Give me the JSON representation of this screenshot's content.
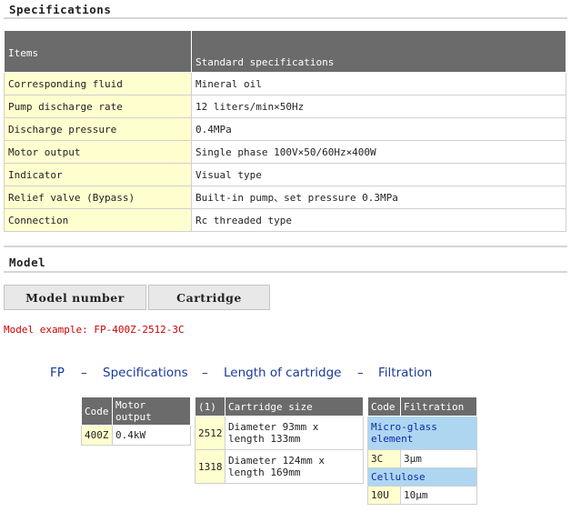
{
  "specifications": {
    "section_title": "Specifications",
    "header": {
      "items": "Items",
      "standard": "Standard specifications"
    },
    "rows": [
      {
        "item": "Corresponding fluid",
        "value": "Mineral oil"
      },
      {
        "item": "Pump discharge rate",
        "value": "12 liters/min×50Hz"
      },
      {
        "item": "Discharge pressure",
        "value": "0.4MPa"
      },
      {
        "item": "Motor output",
        "value": "Single phase 100V×50/60Hz×400W"
      },
      {
        "item": "Indicator",
        "value": "Visual type"
      },
      {
        "item": "Relief valve (Bypass)",
        "value": "Built-in pump、set pressure 0.3MPa"
      },
      {
        "item": "Connection",
        "value": "Rc threaded type"
      }
    ]
  },
  "model": {
    "section_title": "Model",
    "tabs": [
      {
        "label": "Model number",
        "active": true
      },
      {
        "label": "Cartridge",
        "active": false
      }
    ],
    "example": "Model example: FP-400Z-2512-3C",
    "formula": {
      "prefix": "FP",
      "dash": "–",
      "part1": "Specifications",
      "part2": "Length of cartridge",
      "part3": "Filtration"
    },
    "motor_table": {
      "headers": [
        "Code",
        "Motor output"
      ],
      "rows": [
        {
          "code": "400Z",
          "value": "0.4kW"
        }
      ]
    },
    "cartridge_table": {
      "headers": [
        "(1)",
        "Cartridge size"
      ],
      "rows": [
        {
          "code": "2512",
          "value": "Diameter 93mm x length 133mm"
        },
        {
          "code": "1318",
          "value": "Diameter 124mm x length 169mm"
        }
      ]
    },
    "filtration_table": {
      "headers": [
        "Code",
        "Filtration"
      ],
      "groups": [
        {
          "name": "Micro-glass element",
          "rows": [
            {
              "code": "3C",
              "value": "3μm"
            }
          ]
        },
        {
          "name": "Cellulose",
          "rows": [
            {
              "code": "10U",
              "value": "10μm"
            }
          ]
        }
      ]
    }
  },
  "colors": {
    "header_bg": "#6b6b6b",
    "item_bg": "#fefecf",
    "group_bg": "#aed6f1",
    "example_text": "#cc0000",
    "formula_text": "#1a3a9a"
  }
}
